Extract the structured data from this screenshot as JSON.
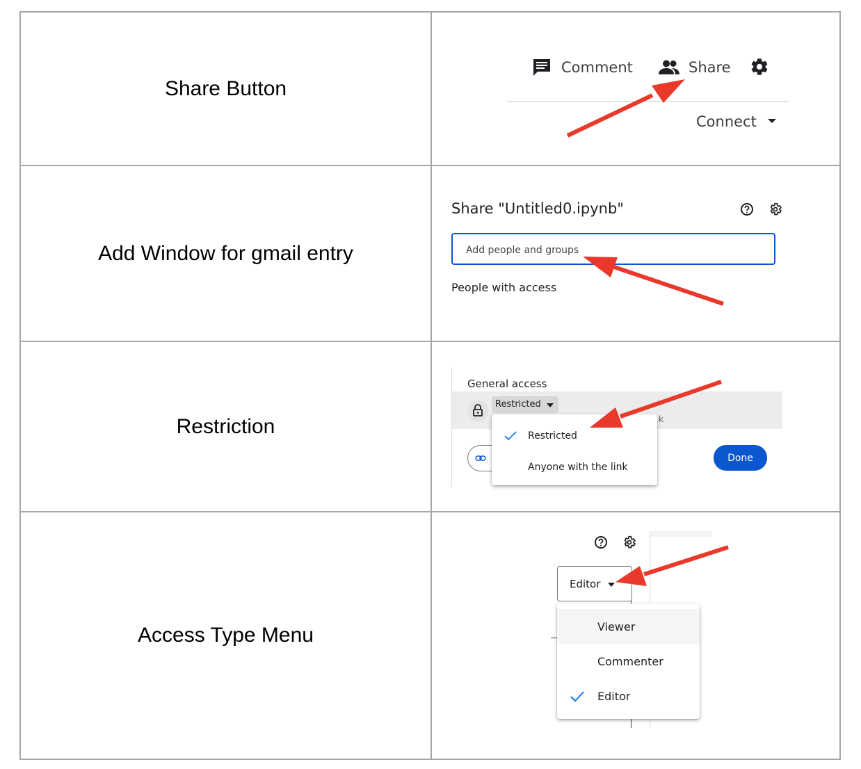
{
  "rows": [
    {
      "label": "Share Button"
    },
    {
      "label": "Add Window for gmail entry"
    },
    {
      "label": "Restriction"
    },
    {
      "label": "Access Type Menu"
    }
  ],
  "shot1": {
    "comment": "Comment",
    "share": "Share",
    "connect": "Connect"
  },
  "shot2": {
    "title": "Share \"Untitled0.ipynb\"",
    "placeholder": "Add people and groups",
    "people": "People with access"
  },
  "shot3": {
    "general": "General access",
    "chip": "Restricted",
    "opt1": "Restricted",
    "opt2": "Anyone with the link",
    "done": "Done",
    "partial": "k"
  },
  "shot4": {
    "editor": "Editor",
    "viewer": "Viewer",
    "commenter": "Commenter",
    "editor_opt": "Editor"
  },
  "colors": {
    "arrow": "#e8392b",
    "accent": "#0b57d0",
    "check": "#1a73e8"
  }
}
